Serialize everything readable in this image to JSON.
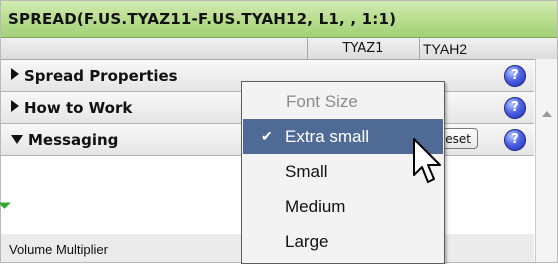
{
  "window": {
    "title": "SPREAD(F.US.TYAZ11-F.US.TYAH12, L1, , 1:1)"
  },
  "columns": {
    "col2_label": "TYAZ1",
    "col3_label": "TYAH2"
  },
  "sections": [
    {
      "label": "Spread Properties",
      "expanded": false,
      "help_icon": "question-mark"
    },
    {
      "label": "How to Work",
      "expanded": false,
      "help_icon": "question-mark"
    },
    {
      "label": "Messaging",
      "expanded": true,
      "help_icon": "question-mark",
      "reset_label": "eset"
    }
  ],
  "plain_row": {
    "label": "Volume Multiplier"
  },
  "context_menu": {
    "header": "Font Size",
    "items": [
      {
        "label": "Extra small",
        "checked": true,
        "highlighted": true
      },
      {
        "label": "Small",
        "checked": false,
        "highlighted": false
      },
      {
        "label": "Medium",
        "checked": false,
        "highlighted": false
      },
      {
        "label": "Large",
        "checked": false,
        "highlighted": false
      }
    ],
    "check_glyph": "✔"
  },
  "help_glyph": "?",
  "colors": {
    "title_bar_green": "#b6dc8c",
    "menu_highlight": "#4f6b95",
    "help_blue": "#4d63e6"
  }
}
